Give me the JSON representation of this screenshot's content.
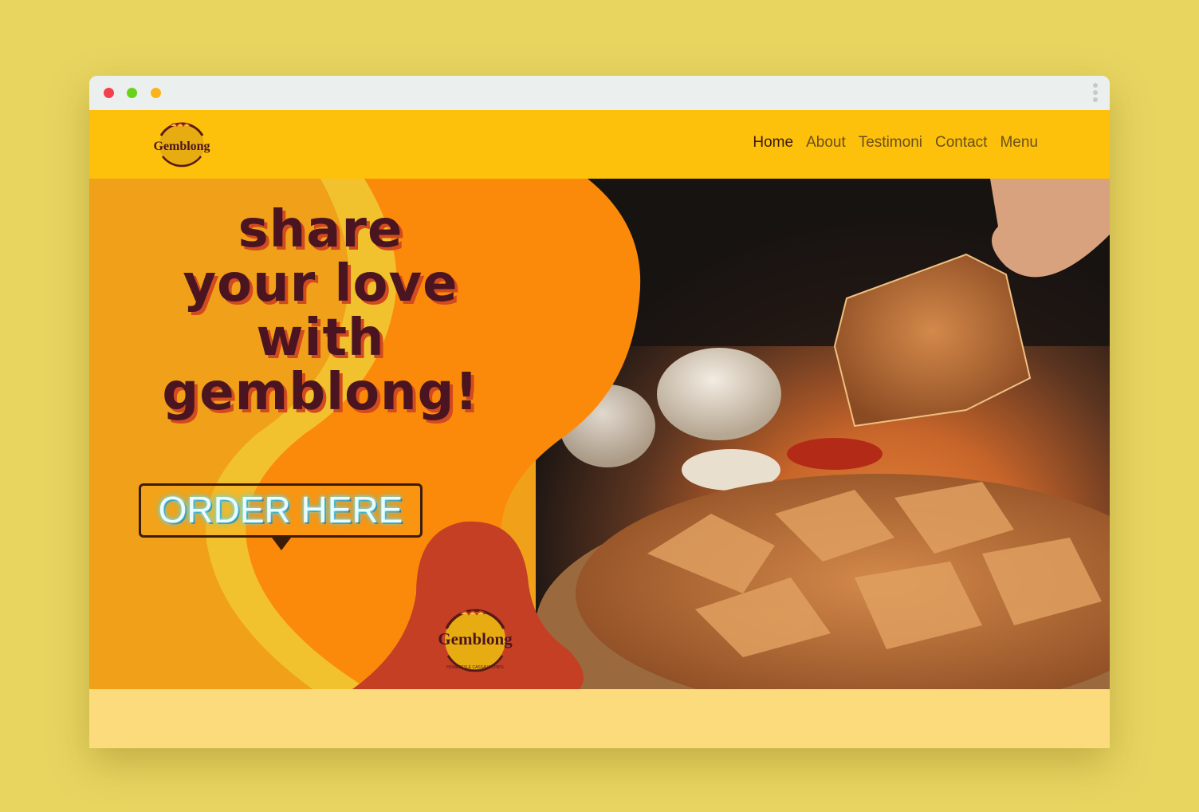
{
  "browser": {
    "controls": [
      "close",
      "minimize",
      "maximize"
    ],
    "menu_icon": "kebab-menu-icon"
  },
  "navbar": {
    "logo_text": "Gemblong",
    "links": [
      {
        "label": "Home",
        "active": true
      },
      {
        "label": "About",
        "active": false
      },
      {
        "label": "Testimoni",
        "active": false
      },
      {
        "label": "Contact",
        "active": false
      },
      {
        "label": "Menu",
        "active": false
      }
    ]
  },
  "hero": {
    "headline": [
      "share",
      "your love",
      "with",
      "gemblong!"
    ],
    "cta_label": "ORDER HERE",
    "badge_logo_text": "Gemblong",
    "badge_logo_tagline": "HOMESTYLE CASSAVA CHIPS"
  },
  "colors": {
    "page_bg": "#e8d560",
    "navbar_bg": "#fdc10c",
    "headline": "#4a1520",
    "headline_shadow": "#d24a1e",
    "blob_orange": "#fb8a0b",
    "blob_yellow": "#f2c22e",
    "blob_red": "#c53f25",
    "footer_band": "#fcdb7c"
  }
}
